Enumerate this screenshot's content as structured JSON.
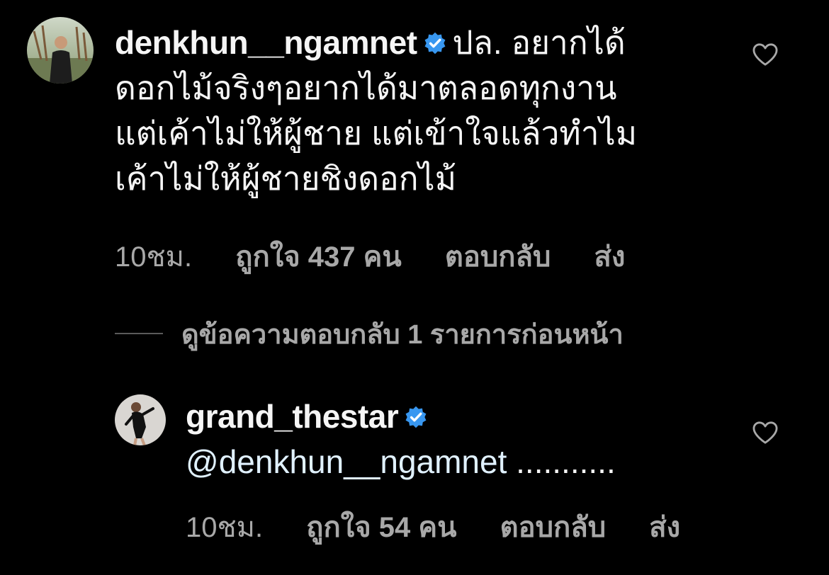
{
  "comment": {
    "username": "denkhun__ngamnet",
    "verified": true,
    "text_lines": [
      "ปล. อยากได้",
      "ดอกไม้จริงๆอยากได้มาตลอดทุกงาน",
      "แต่เค้าไม่ให้ผู้ชาย แต่เข้าใจแล้วทำไม",
      "เค้าไม่ให้ผู้ชายชิงดอกไม้"
    ],
    "time": "10ชม.",
    "likes": "ถูกใจ 437 คน",
    "reply_label": "ตอบกลับ",
    "send_label": "ส่ง"
  },
  "view_replies": {
    "label": "ดูข้อความตอบกลับ 1 รายการก่อนหน้า"
  },
  "reply": {
    "username": "grand_thestar",
    "verified": true,
    "mention": "@denkhun__ngamnet",
    "text": " ...........",
    "time": "10ชม.",
    "likes": "ถูกใจ 54 คน",
    "reply_label": "ตอบกลับ",
    "send_label": "ส่ง"
  },
  "colors": {
    "background": "#000000",
    "text": "#f5f5f5",
    "muted": "#a8a8a8",
    "verified": "#3897f0",
    "mention": "#e0f1ff"
  },
  "icons": {
    "verified": "verified-badge-icon",
    "like": "heart-outline-icon"
  }
}
